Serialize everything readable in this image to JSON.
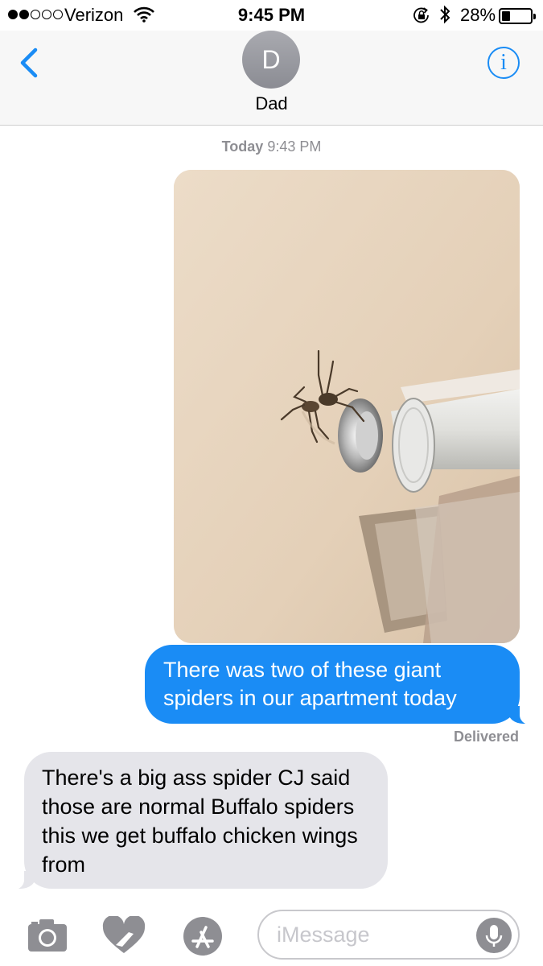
{
  "status_bar": {
    "carrier": "Verizon",
    "time": "9:45 PM",
    "battery_percent": "28%",
    "battery_level": 0.28,
    "signal_bars_filled": 2,
    "signal_bars_total": 5
  },
  "header": {
    "avatar_initial": "D",
    "contact_name": "Dad",
    "info_icon": "i"
  },
  "conversation": {
    "timestamp_day": "Today",
    "timestamp_time": "9:43 PM",
    "sent_message": "There was two of these giant spiders in our apartment today",
    "delivery_status": "Delivered",
    "received_message": "There's a big ass spider CJ said those are normal Buffalo spiders this we get buffalo chicken wings from"
  },
  "input_bar": {
    "placeholder": "iMessage"
  },
  "colors": {
    "accent": "#1a8cf5",
    "received_bubble": "#e5e5ea",
    "secondary_text": "#8e8e93"
  }
}
